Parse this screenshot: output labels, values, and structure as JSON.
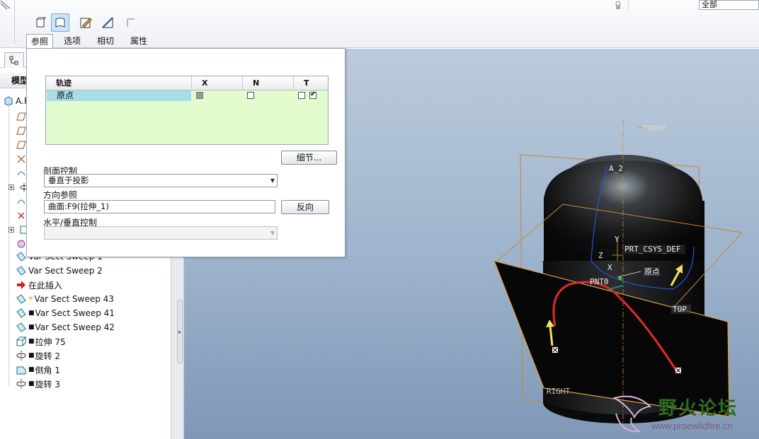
{
  "toolbar": {
    "tools": [
      "solid-icon",
      "surface-icon",
      "sketch-icon",
      "section-icon",
      "thin-icon"
    ],
    "tabs": [
      "参照",
      "选项",
      "相切",
      "属性"
    ],
    "active_tab": "参照",
    "filter_value": "全部"
  },
  "model_tree": {
    "heading": "模型",
    "root": "A.P",
    "items": [
      {
        "label": "Var Sect Sweep 1",
        "icon": "var-sect-sweep-icon"
      },
      {
        "label": "Var Sect Sweep 2",
        "icon": "var-sect-sweep-icon"
      },
      {
        "label": "在此插入",
        "icon": "insert-here-arrow-icon"
      },
      {
        "label": "Var Sect Sweep 43",
        "icon": "var-sect-sweep-icon"
      },
      {
        "label": "Var Sect Sweep 41",
        "icon": "var-sect-sweep-icon"
      },
      {
        "label": "Var Sect Sweep 42",
        "icon": "var-sect-sweep-icon"
      },
      {
        "label": "拉伸 75",
        "icon": "extrude-icon"
      },
      {
        "label": "旋转 2",
        "icon": "revolve-icon"
      },
      {
        "label": "倒角 1",
        "icon": "chamfer-icon"
      },
      {
        "label": "旋转 3",
        "icon": "revolve-icon"
      }
    ]
  },
  "references": {
    "table_headers": [
      "轨迹",
      "X",
      "N",
      "T"
    ],
    "rows": [
      {
        "name": "原点",
        "x": "grey",
        "n": "off",
        "t": [
          "off",
          "on"
        ]
      }
    ],
    "details_button": "细节...",
    "section_control_label": "剖面控制",
    "section_control_value": "垂直于投影",
    "direction_ref_label": "方向参照",
    "direction_ref_value": "曲面:F9(拉伸_1)",
    "flip_button": "反向",
    "hv_control_label": "水平/垂直控制",
    "hv_control_value": ""
  },
  "viewport": {
    "datum_labels": [
      "FRONT",
      "A_2",
      "PRT_CSYS_DEF",
      "Z",
      "Y",
      "X",
      "原点",
      "PNT0",
      "TOP",
      "RIGHT"
    ],
    "body_color": "#1a1a1a",
    "datum_color": "#c8843a",
    "trajectory_color": "#e02a2a",
    "direction_arrow_color": "#f4e060"
  },
  "watermark": {
    "title": "野火论坛",
    "url": "www.proewildfire.cn"
  }
}
